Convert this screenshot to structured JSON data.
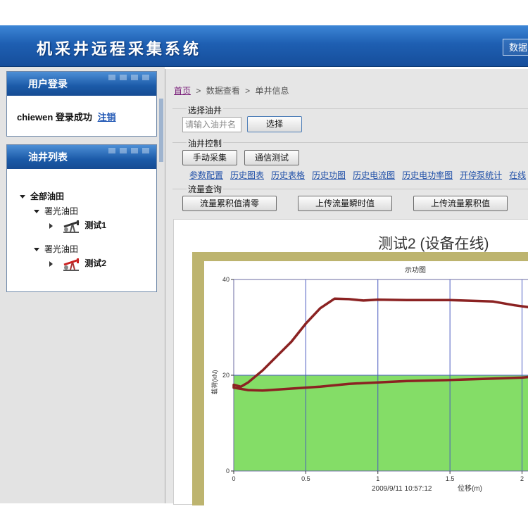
{
  "app": {
    "title": "机采井远程采集系统",
    "header_button": "数据"
  },
  "login": {
    "header": "用户登录",
    "username": "chiewen",
    "status": "登录成功",
    "logout": "注销"
  },
  "well_list": {
    "header": "油井列表",
    "root": "全部油田",
    "fields": [
      {
        "name": "署光油田",
        "wells": [
          "测试1"
        ]
      },
      {
        "name": "署光油田",
        "wells": [
          "测试2"
        ]
      }
    ]
  },
  "breadcrumb": {
    "home": "首页",
    "sep": ">",
    "level1": "数据查看",
    "level2": "单井信息"
  },
  "select_well": {
    "label": "选择油井",
    "placeholder": "请输入油井名",
    "button": "选择"
  },
  "well_control": {
    "label": "油井控制",
    "buttons": [
      "手动采集",
      "通信测试"
    ],
    "links": [
      "参数配置",
      "历史图表",
      "历史表格",
      "历史功图",
      "历史电流图",
      "历史电功率图",
      "开停泵统计",
      "在线"
    ]
  },
  "flow_query": {
    "label": "流量查询",
    "buttons": [
      "流量累积值清零",
      "上传流量瞬时值",
      "上传流量累积值"
    ]
  },
  "chart_data": {
    "type": "line",
    "heading": "测试2 (设备在线)",
    "title": "示功图",
    "xlabel": "位移(m)",
    "ylabel": "载荷(kN)",
    "timestamp": "2009/9/11 10:57:12",
    "xlim": [
      0,
      2.1
    ],
    "ylim": [
      0,
      40
    ],
    "xticks": [
      0,
      0.5,
      1,
      1.5,
      2
    ],
    "yticks": [
      0,
      20,
      40
    ],
    "tick_labels": {
      "x": [
        "0",
        "0.5",
        "1",
        "1.5",
        "2"
      ],
      "y": [
        "0",
        "20",
        "40"
      ]
    },
    "band": {
      "ymin": 0,
      "ymax": 20,
      "color": "#84dd67"
    },
    "line_color": "#8b2222",
    "series": [
      {
        "points": [
          [
            0,
            18
          ],
          [
            0.05,
            17.6
          ],
          [
            0.1,
            18.5
          ],
          [
            0.2,
            21
          ],
          [
            0.3,
            24
          ],
          [
            0.4,
            27
          ],
          [
            0.5,
            30.8
          ],
          [
            0.6,
            34
          ],
          [
            0.7,
            36
          ],
          [
            0.8,
            35.9
          ],
          [
            0.9,
            35.6
          ],
          [
            1.0,
            35.8
          ],
          [
            1.2,
            35.7
          ],
          [
            1.5,
            35.7
          ],
          [
            1.8,
            35.4
          ],
          [
            1.95,
            34.6
          ],
          [
            2.1,
            34.0
          ],
          [
            2.1,
            19.8
          ],
          [
            2.0,
            19.5
          ],
          [
            1.8,
            19.3
          ],
          [
            1.5,
            19.0
          ],
          [
            1.2,
            18.8
          ],
          [
            1.0,
            18.5
          ],
          [
            0.8,
            18.2
          ],
          [
            0.6,
            17.6
          ],
          [
            0.4,
            17.2
          ],
          [
            0.2,
            16.8
          ],
          [
            0.1,
            16.9
          ],
          [
            0,
            17.4
          ]
        ]
      }
    ]
  }
}
